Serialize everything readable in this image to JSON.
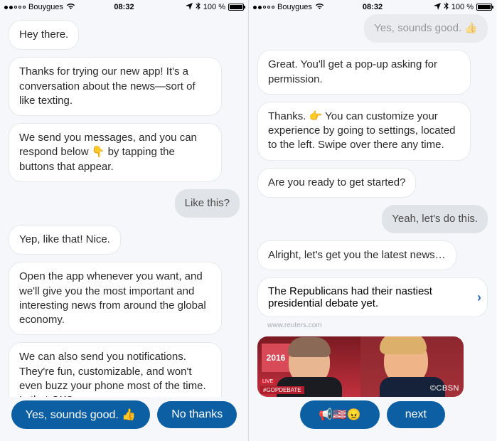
{
  "status": {
    "carrier": "Bouygues",
    "time": "08:32",
    "battery_text": "100 %"
  },
  "left": {
    "b1": "Hey there.",
    "b2": "Thanks for trying our new app! It's a conversation about the news—sort of like texting.",
    "b3": "We send you messages, and you can respond below 👇 by tapping the buttons that appear.",
    "r1": "Like this?",
    "b4": "Yep, like that! Nice.",
    "b5": "Open the app whenever you want, and we'll give you the most important and interesting news from around the global economy.",
    "b6": "We can also send you notifications. They're fun, customizable, and won't even buzz your phone most of the time. Is that OK?",
    "btn_yes": "Yes, sounds good. 👍",
    "btn_no": "No thanks"
  },
  "right": {
    "r0": "Yes, sounds good. 👍",
    "b1": "Great. You'll get a pop-up asking for permission.",
    "b2": "Thanks. 👉 You can customize your experience by going to settings, located to the left. Swipe over there any time.",
    "b3": "Are you ready to get started?",
    "r1": "Yeah, let's do this.",
    "b4": "Alright, let's get you the latest news…",
    "headline": "The Republicans had their nastiest presidential debate yet.",
    "source": "www.reuters.com",
    "media_year": "2016",
    "media_banner": "#GOPDEBATE",
    "media_live": "LIVE",
    "media_net": "©CBSN",
    "btn_react": "📢🇺🇸😠",
    "btn_next": "next"
  }
}
